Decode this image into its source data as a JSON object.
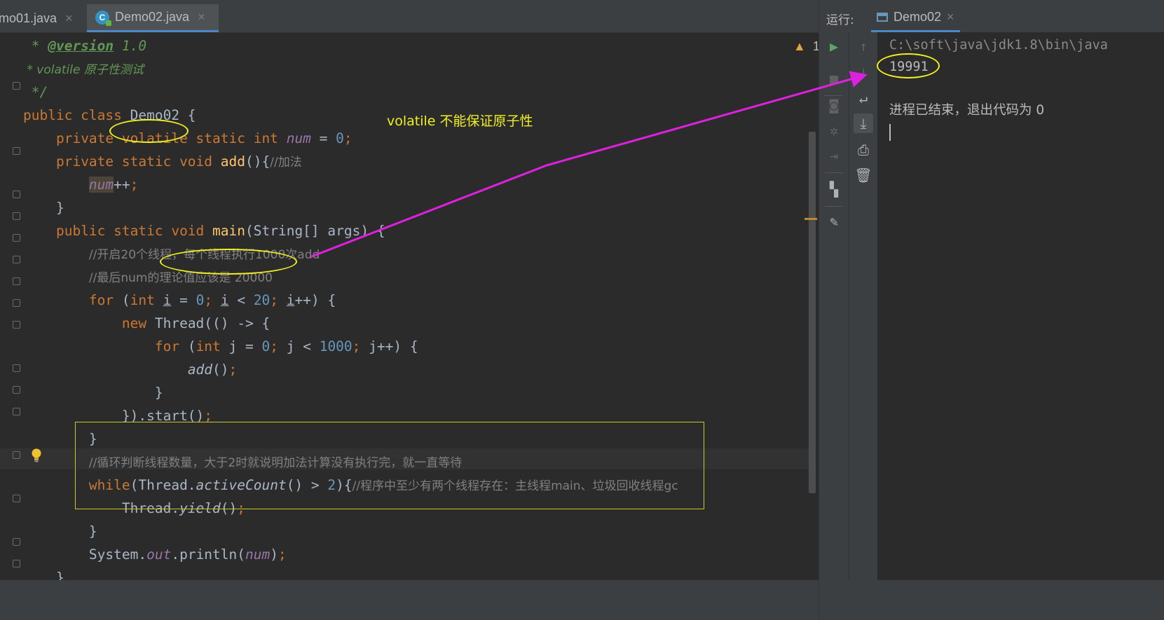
{
  "editor": {
    "tabs": [
      {
        "label": "emo01.java",
        "close": "×"
      },
      {
        "label": "Demo02.java",
        "close": "×",
        "icon": "java-class-icon"
      }
    ],
    "inspection": {
      "warning_icon": "warning-icon",
      "count": "1",
      "up": "⌃",
      "down": "⌄"
    },
    "code": {
      "l1_star": " * ",
      "l1_tag": "@version",
      "l1_val": " 1.0",
      "l2": " * volatile 原子性测试",
      "l3": " */",
      "l4_kw": "public class ",
      "l4_name": "Demo02 {",
      "l5_kw1": "private ",
      "l5_volatile": "volatile",
      "l5_kw2": " static int ",
      "l5_field": "num",
      "l5_eq": " = ",
      "l5_num": "0",
      "l5_semi": ";",
      "l6_kw": "private static void ",
      "l6_name": "add",
      "l6_rest": "(){",
      "l6_cm": "//加法",
      "l7_field": "num",
      "l7_rest": "++",
      "l7_semi": ";",
      "l8": "}",
      "l9_kw": "public static void ",
      "l9_name": "main",
      "l9_rest": "(String[] args) {",
      "l10_cm": "//开启20个线程，每个线程执行1000次add",
      "l11_cm": "//最后num的理论值应该是 20000",
      "l12_for": "for ",
      "l12_p1": "(",
      "l12_int": "int ",
      "l12_i1": "i",
      "l12_eq": " = ",
      "l12_n0": "0",
      "l12_sc1": "; ",
      "l12_i2": "i",
      "l12_lt": " < ",
      "l12_n20": "20",
      "l12_sc2": "; ",
      "l12_i3": "i",
      "l12_end": "++) {",
      "l13_new": "new ",
      "l13_rest": "Thread(() -> {",
      "l14_for": "for ",
      "l14_p1": "(",
      "l14_int": "int ",
      "l14_j": "j = ",
      "l14_n0": "0",
      "l14_sc1": "; ",
      "l14_j2": "j < ",
      "l14_n1000": "1000",
      "l14_sc2": "; ",
      "l14_end": "j++) {",
      "l15_call": "add",
      "l15_rest": "()",
      "l15_semi": ";",
      "l16": "}",
      "l17_rest": "}).start()",
      "l17_semi": ";",
      "l18": "}",
      "l19_cm": "//循环判断线程数量，大于2时就说明加法计算没有执行完，就一直等待",
      "l20_while": "while",
      "l20_p": "(Thread.",
      "l20_m": "activeCount",
      "l20_gt": "() > ",
      "l20_n2": "2",
      "l20_b": "){",
      "l20_cm": "//程序中至少有两个线程存在：主线程main、垃圾回收线程gc",
      "l21_p": "Thread.",
      "l21_m": "yield",
      "l21_rest": "()",
      "l21_semi": ";",
      "l22": "}",
      "l23_p": "System.",
      "l23_out": "out",
      "l23_rest": ".println(",
      "l23_field": "num",
      "l23_end": ")",
      "l23_semi": ";",
      "l24": "}",
      "l25": "}"
    },
    "annotation": "volatile 不能保证原子性"
  },
  "run": {
    "title": "运行:",
    "tab_label": "Demo02",
    "tab_close": "×",
    "toolbar_left": [
      "rerun-icon",
      "stop-icon",
      "camera-icon",
      "debug-settings-icon",
      "exit-icon",
      "layout-icon",
      "pin-icon"
    ],
    "toolbar_right": [
      "up-arrow-icon",
      "down-arrow-icon",
      "soft-wrap-icon",
      "scroll-to-end-icon",
      "print-icon",
      "trash-icon"
    ],
    "console": {
      "path": "C:\\soft\\java\\jdk1.8\\bin\\java",
      "result": "19991",
      "exit_message": "进程已结束，退出代码为 0"
    }
  },
  "colors": {
    "annotation_yellow": "#f0f020",
    "arrow_magenta": "#e020e0",
    "keyword": "#cc7832",
    "number": "#6897bb",
    "comment": "#808080",
    "field": "#9876aa",
    "method": "#ffc66d"
  }
}
